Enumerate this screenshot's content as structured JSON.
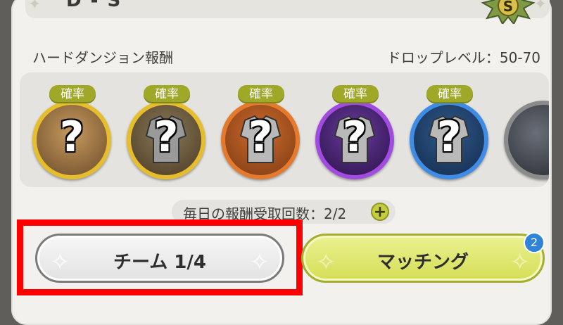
{
  "dungeon": {
    "rank_range": "D - S",
    "rank_badge_letter": "S",
    "reward_title": "ハードダンジョン報酬",
    "drop_level": "ドロップレベル：50-70"
  },
  "rewards": [
    {
      "tag": "確率",
      "mark": "?",
      "ring_color": "#e6bd2c",
      "inner_color": "#6b4b2a",
      "item_icon": "scroll-item-icon"
    },
    {
      "tag": "確率",
      "mark": "?",
      "ring_color": "#e6bd2c",
      "inner_color": "#5a4628",
      "item_icon": "armor-item-icon"
    },
    {
      "tag": "確率",
      "mark": "?",
      "ring_color": "#e67a2c",
      "inner_color": "#7a3b15",
      "item_icon": "armor-item-icon"
    },
    {
      "tag": "確率",
      "mark": "?",
      "ring_color": "#a14be0",
      "inner_color": "#3e1f66",
      "item_icon": "armor-item-icon"
    },
    {
      "tag": "確率",
      "mark": "?",
      "ring_color": "#3e8ce6",
      "inner_color": "#1d3c66",
      "item_icon": "armor-item-icon"
    }
  ],
  "daily": {
    "text": "毎日の報酬受取回数：2/2",
    "plus": "+"
  },
  "buttons": {
    "team_label": "チーム 1/4",
    "matching_label": "マッチング",
    "matching_badge": "2"
  },
  "colors": {
    "accent_green": "#c6cd3d",
    "highlight_red": "#ff0000",
    "notification_blue": "#2f83d8"
  }
}
